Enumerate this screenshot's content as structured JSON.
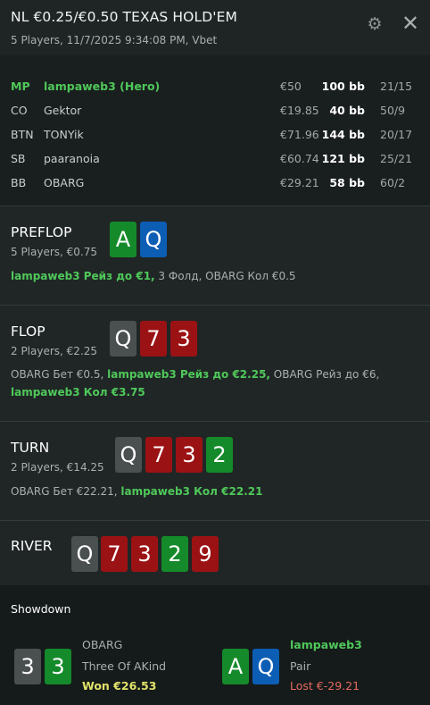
{
  "header": {
    "title": "NL €0.25/€0.50 TEXAS HOLD'EM",
    "subtitle": "5 Players, 11/7/2025 9:34:08 PM, Vbet",
    "settings_icon": "gear-icon",
    "close_icon": "close-icon"
  },
  "players": [
    {
      "pos": "MP",
      "name": "lampaweb3 (Hero)",
      "stack": "€50",
      "bb": "100 bb",
      "stat": "21/15"
    },
    {
      "pos": "CO",
      "name": "Gektor",
      "stack": "€19.85",
      "bb": "40 bb",
      "stat": "50/9"
    },
    {
      "pos": "BTN",
      "name": "TONYik",
      "stack": "€71.96",
      "bb": "144 bb",
      "stat": "20/17"
    },
    {
      "pos": "SB",
      "name": "paaranoia",
      "stack": "€60.74",
      "bb": "121 bb",
      "stat": "25/21"
    },
    {
      "pos": "BB",
      "name": "OBARG",
      "stack": "€29.21",
      "bb": "58 bb",
      "stat": "60/2"
    }
  ],
  "streets": {
    "preflop": {
      "name": "PREFLOP",
      "info": "5 Players, €0.75",
      "cards": [
        {
          "rank": "A",
          "suit": "club"
        },
        {
          "rank": "Q",
          "suit": "diamond"
        }
      ],
      "actions": {
        "a1": "lampaweb3 Рейз до €1,",
        "a2": " 3 Фолд, OBARG Кол €0.5"
      }
    },
    "flop": {
      "name": "FLOP",
      "info": "2 Players, €2.25",
      "cards": [
        {
          "rank": "Q",
          "suit": "spade"
        },
        {
          "rank": "7",
          "suit": "heart"
        },
        {
          "rank": "3",
          "suit": "heart"
        }
      ],
      "actions": {
        "a1": "OBARG Бет €0.5, ",
        "a2": "lampaweb3 Рейз до €2.25,",
        "a3": " OBARG Рейз до €6, ",
        "a4": "lampaweb3 Кол €3.75"
      }
    },
    "turn": {
      "name": "TURN",
      "info": "2 Players, €14.25",
      "cards": [
        {
          "rank": "Q",
          "suit": "spade"
        },
        {
          "rank": "7",
          "suit": "heart"
        },
        {
          "rank": "3",
          "suit": "heart"
        },
        {
          "rank": "2",
          "suit": "club"
        }
      ],
      "actions": {
        "a1": "OBARG Бет €22.21, ",
        "a2": "lampaweb3 Кол €22.21"
      }
    },
    "river": {
      "name": "RIVER",
      "cards": [
        {
          "rank": "Q",
          "suit": "spade"
        },
        {
          "rank": "7",
          "suit": "heart"
        },
        {
          "rank": "3",
          "suit": "heart"
        },
        {
          "rank": "2",
          "suit": "club"
        },
        {
          "rank": "9",
          "suit": "heart"
        }
      ]
    }
  },
  "showdown": {
    "title": "Showdown",
    "villain": {
      "name": "OBARG",
      "hand": "Three Of AKind",
      "result": "Won €26.53",
      "cards": [
        {
          "rank": "3",
          "suit": "spade"
        },
        {
          "rank": "3",
          "suit": "club"
        }
      ]
    },
    "hero": {
      "name": "lampaweb3",
      "hand": "Pair",
      "result": "Lost €-29.21",
      "cards": [
        {
          "rank": "A",
          "suit": "club"
        },
        {
          "rank": "Q",
          "suit": "diamond"
        }
      ]
    }
  },
  "colors": {
    "club": "#158a2a",
    "diamond": "#0c5db4",
    "heart": "#9b1214",
    "spade": "#4a4f50",
    "hero_green": "#4fc85a"
  }
}
